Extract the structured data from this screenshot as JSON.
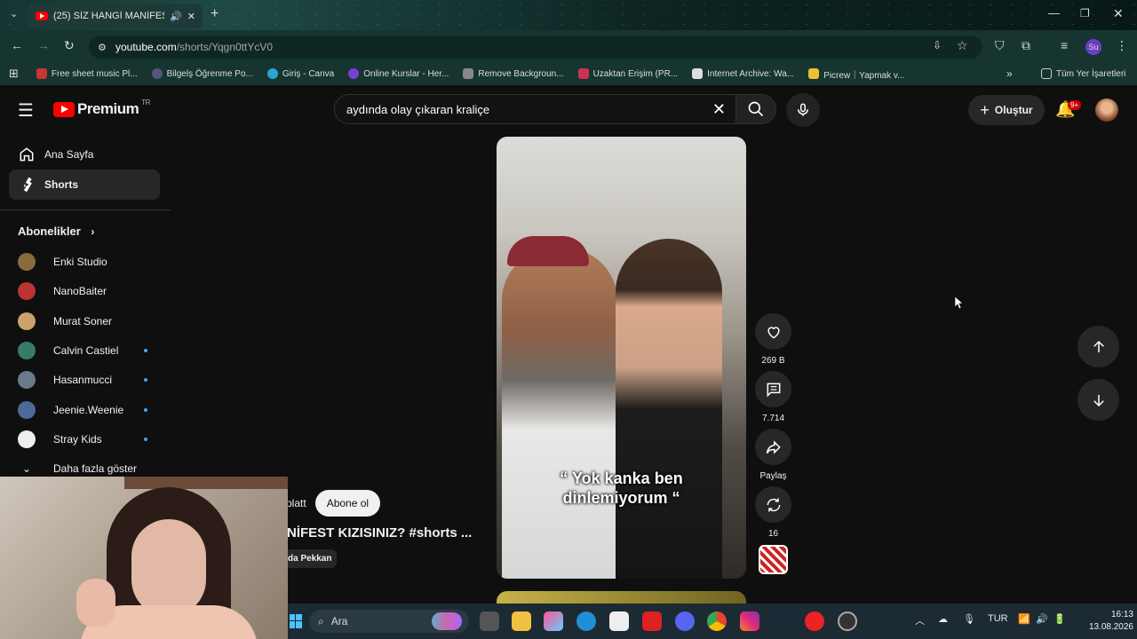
{
  "browser": {
    "tab_title": "(25) SİZ HANGİ MANİFEST",
    "url_host": "youtube.com",
    "url_path": "/shorts/Yqgn0ttYcV0",
    "profile_initials": "Su",
    "bookmarks": [
      "Free sheet music Pl...",
      "Bilgelş Öğrenme Po...",
      "Giriş - Canva",
      "Online Kurslar - Her...",
      "Remove Backgroun...",
      "Uzaktan Erişim (PR...",
      "Internet Archive: Wa...",
      "Picrew｜Yapmak v..."
    ],
    "all_bookmarks": "Tüm Yer İşaretleri"
  },
  "header": {
    "logo_text": "Premium",
    "logo_region": "TR",
    "search_value": "aydında olay çıkaran kraliçe",
    "create_label": "Oluştur",
    "notif_count": "9+"
  },
  "sidebar": {
    "home": "Ana Sayfa",
    "shorts": "Shorts",
    "subs_title": "Abonelikler",
    "subscriptions": [
      {
        "name": "Enki Studio",
        "color": "#8a6a3a",
        "dot": false
      },
      {
        "name": "NanoBaiter",
        "color": "#b33",
        "dot": false
      },
      {
        "name": "Murat Soner",
        "color": "#c9a36a",
        "dot": false
      },
      {
        "name": "Calvin Castiel",
        "color": "#3a7a6a",
        "dot": true
      },
      {
        "name": "Hasanmucci",
        "color": "#6a7a8a",
        "dot": true
      },
      {
        "name": "Jeenie.Weenie",
        "color": "#4a6a9a",
        "dot": true
      },
      {
        "name": "Stray Kids",
        "color": "#eeeeee",
        "dot": true
      }
    ],
    "show_more": "Daha fazla göster"
  },
  "short": {
    "caption_line1": "“ Yok kanka ben",
    "caption_line2": "dinlemiyorum “",
    "channel_partial": "platt",
    "subscribe_label": "Abone ol",
    "title_partial": "NİFEST KIZISINIZ? #shorts ...",
    "sound_partial": "da Pekkan",
    "likes": "269 B",
    "comments": "7.714",
    "share": "Paylaş",
    "remix": "16"
  },
  "taskbar": {
    "search_label": "Ara",
    "lang": "TUR",
    "time": "16:13",
    "date": "13.08.2026"
  }
}
